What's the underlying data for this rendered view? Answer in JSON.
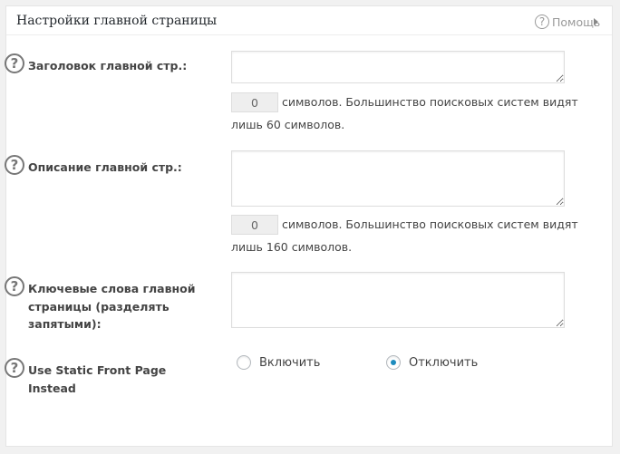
{
  "panel": {
    "title": "Настройки главной страницы",
    "help_icon": "help-circle-icon",
    "help_label": "Помощь",
    "collapse_icon": "caret-icon"
  },
  "fields": {
    "home_title": {
      "help_icon": "help-circle-icon",
      "label": "Заголовок главной стр.:",
      "value": "",
      "counter": "0",
      "note": "символов. Большинство поисковых систем видят",
      "note2": "лишь 60 символов."
    },
    "home_description": {
      "help_icon": "help-circle-icon",
      "label": "Описание главной стр.:",
      "value": "",
      "counter": "0",
      "note": "символов. Большинство поисковых систем видят",
      "note2": "лишь 160 символов."
    },
    "home_keywords": {
      "help_icon": "help-circle-icon",
      "label_lines": [
        "Ключевые слова главной",
        "страницы (разделять",
        "запятыми):"
      ],
      "value": ""
    },
    "static_front": {
      "help_icon": "help-circle-icon",
      "label_lines": [
        "Use Static Front Page",
        "Instead"
      ],
      "options": [
        {
          "label": "Включить",
          "checked": false
        },
        {
          "label": "Отключить",
          "checked": true
        }
      ]
    }
  },
  "colors": {
    "accent": "#1e8cbe",
    "border": "#dddddd",
    "text": "#444444"
  }
}
